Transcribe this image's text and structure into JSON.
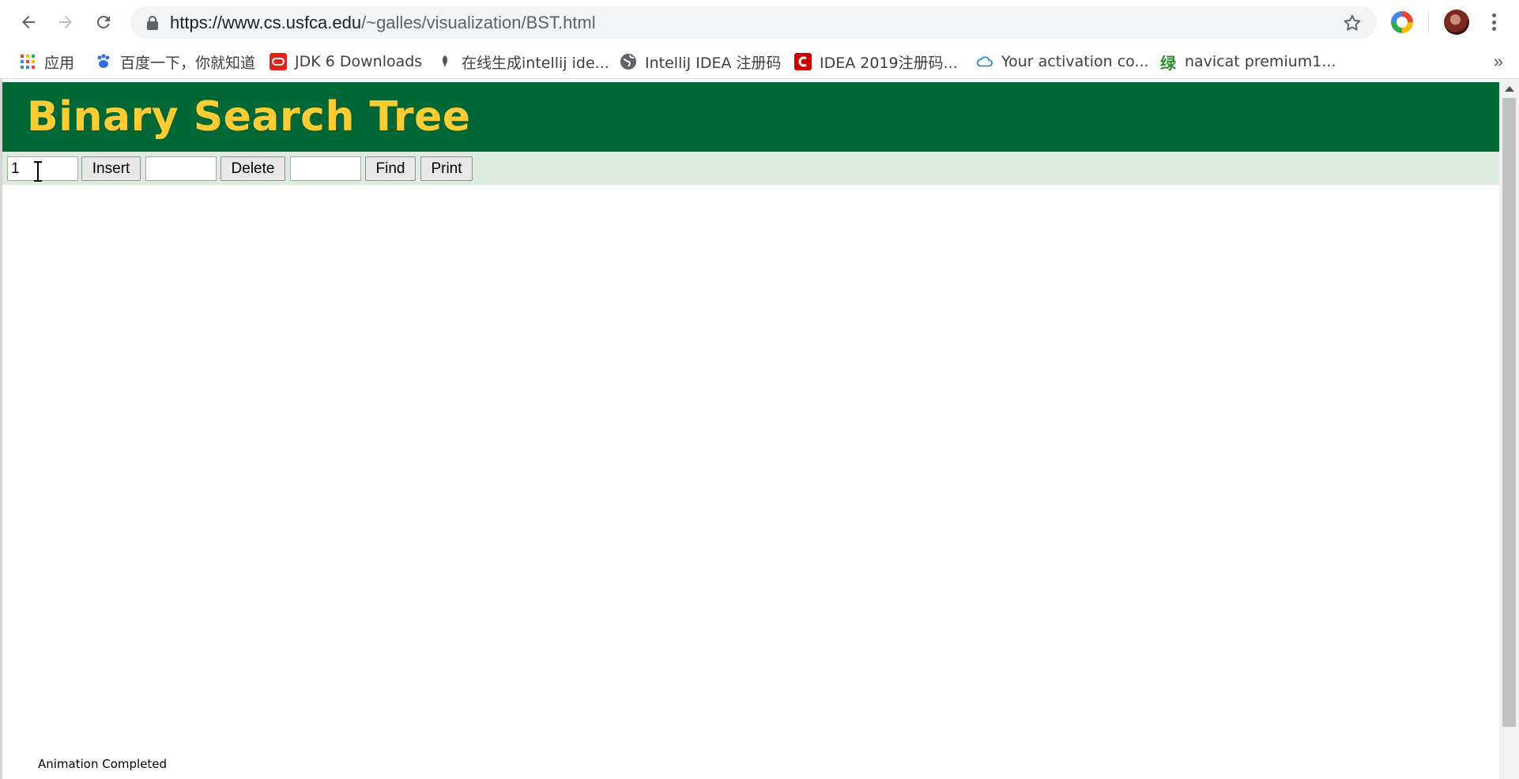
{
  "browser": {
    "url_host": "https://www.cs.usfca.edu",
    "url_path": "/~galles/visualization/BST.html",
    "bookmarks": [
      {
        "label": "应用",
        "icon": "apps-grid-icon"
      },
      {
        "label": "百度一下，你就知道",
        "icon": "baidu-paw-icon"
      },
      {
        "label": "JDK 6 Downloads",
        "icon": "oracle-icon"
      },
      {
        "label": "在线生成intellij ide...",
        "icon": "feather-icon"
      },
      {
        "label": "IntelliJ IDEA 注册码",
        "icon": "globe-icon"
      },
      {
        "label": "IDEA 2019注册码...",
        "icon": "csdn-c-icon"
      },
      {
        "label": "Your activation co...",
        "icon": "cloud-icon"
      },
      {
        "label": "navicat premium1...",
        "icon": "green-char-icon"
      }
    ],
    "more_label": "»",
    "green_char": "绿"
  },
  "page": {
    "title": "Binary Search Tree",
    "insert_value": "1",
    "insert_label": "Insert",
    "delete_value": "",
    "delete_label": "Delete",
    "find_value": "",
    "find_label": "Find",
    "print_label": "Print",
    "status": "Animation Completed"
  },
  "colors": {
    "header_bg": "#006633",
    "header_text": "#ffcc33",
    "controls_bg": "#dcecdf"
  }
}
